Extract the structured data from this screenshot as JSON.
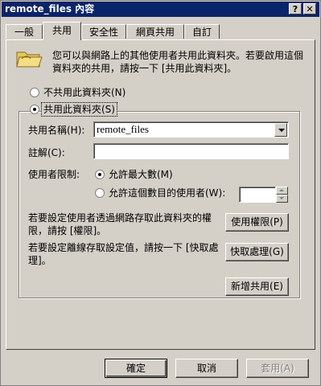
{
  "window": {
    "title": "remote_files 內容",
    "help_glyph": "?",
    "close_glyph": "✕"
  },
  "tabs": [
    {
      "label": "一般",
      "active": false
    },
    {
      "label": "共用",
      "active": true
    },
    {
      "label": "安全性",
      "active": false
    },
    {
      "label": "網頁共用",
      "active": false
    },
    {
      "label": "自訂",
      "active": false
    }
  ],
  "description": "您可以與網路上的其他使用者共用此資料夾。若要啟用這個資料夾的共用，請按一下 [共用此資料夾]。",
  "options": {
    "no_share_label": "不共用此資料夾(N)",
    "share_label": "共用此資料夾(S)",
    "share_selected": true
  },
  "share": {
    "name_label": "共用名稱(H):",
    "name_value": "remote_files",
    "comment_label": "註解(C):",
    "comment_value": "",
    "user_limit_label": "使用者限制:",
    "max_allowed_label": "允許最大數(M)",
    "allow_users_label": "允許這個數目的使用者(W):",
    "allow_users_value": "",
    "max_selected": true
  },
  "permissions": {
    "text": "若要設定使用者透過網路存取此資料夾的權限，請按 [權限]。",
    "button_label": "使用權限(P)"
  },
  "caching": {
    "text": "若要設定離線存取設定值，請按一下 [快取處理]。",
    "button_label": "快取處理(G)"
  },
  "new_share_label": "新增共用(E)",
  "footer": {
    "ok_label": "確定",
    "cancel_label": "取消",
    "apply_label": "套用(A)"
  },
  "colors": {
    "titlebar": "#0a246a",
    "face": "#d4d0c8"
  }
}
